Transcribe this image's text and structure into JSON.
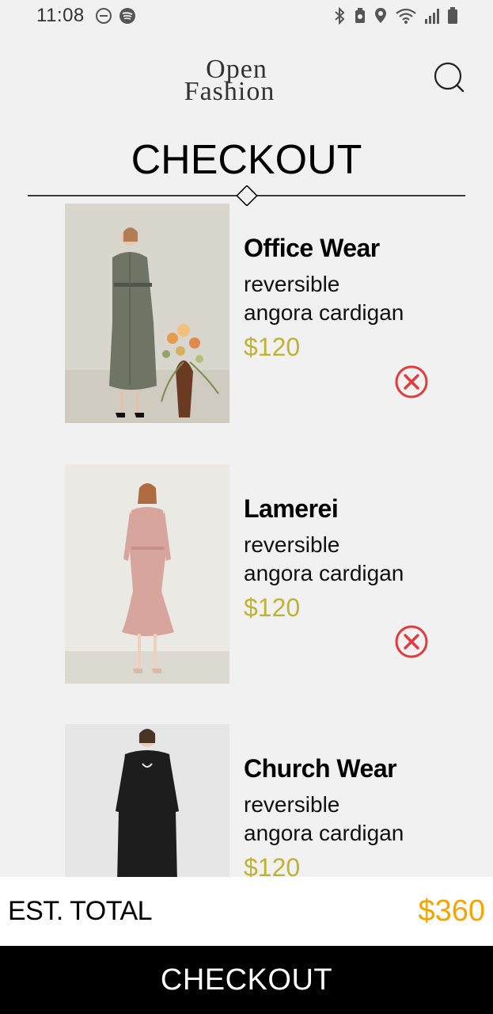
{
  "status_bar": {
    "time": "11:08",
    "left_icons": [
      "do-not-disturb-icon",
      "spotify-icon"
    ],
    "right_icons": [
      "bluetooth-icon",
      "battery-saver-icon",
      "location-icon",
      "wifi-icon",
      "cell-signal-icon",
      "battery-icon"
    ]
  },
  "header": {
    "logo_line1": "Open",
    "logo_line2": "Fashion",
    "search_icon": "search-icon"
  },
  "page": {
    "title": "CHECKOUT"
  },
  "cart": {
    "items": [
      {
        "brand": "Office Wear",
        "desc_line1": "reversible",
        "desc_line2": "angora cardigan",
        "price": "$120",
        "remove_icon": "remove-circle-x-icon"
      },
      {
        "brand": "Lamerei",
        "desc_line1": "reversible",
        "desc_line2": "angora cardigan",
        "price": "$120",
        "remove_icon": "remove-circle-x-icon"
      },
      {
        "brand": "Church Wear",
        "desc_line1": "reversible",
        "desc_line2": "angora cardigan",
        "price": "$120"
      }
    ]
  },
  "summary": {
    "total_label": "EST. TOTAL",
    "total_value": "$360"
  },
  "footer": {
    "checkout_label": "CHECKOUT"
  },
  "colors": {
    "background": "#f1f1f1",
    "price": "#bfb335",
    "total_value": "#f7a400",
    "remove": "#e23b3b",
    "checkout_bar": "#000000"
  }
}
